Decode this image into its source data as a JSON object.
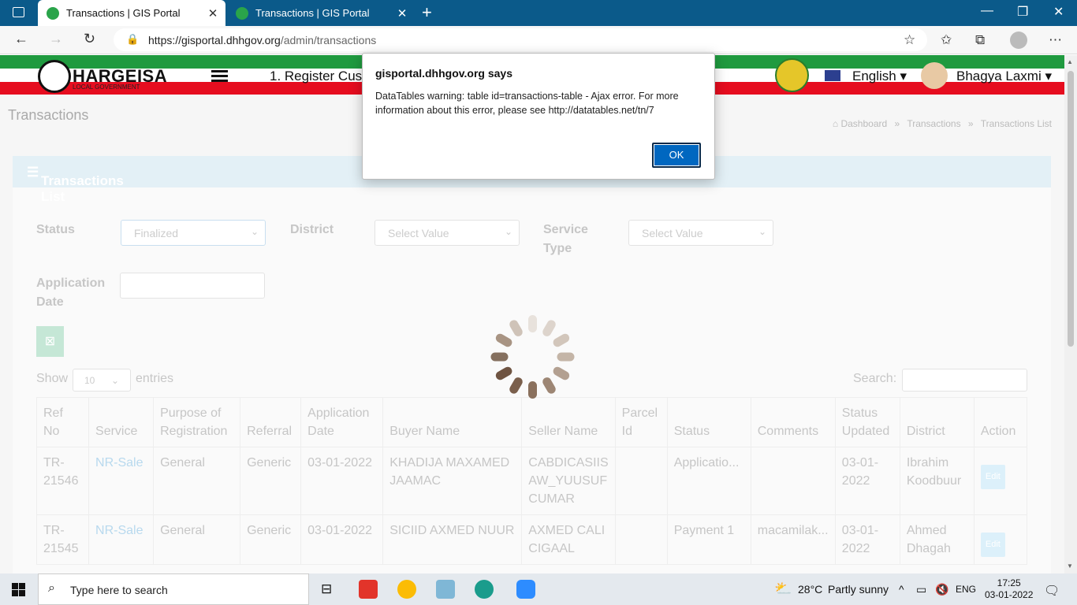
{
  "browser": {
    "tabs": [
      {
        "title": "Transactions | GIS Portal",
        "active": true
      },
      {
        "title": "Transactions | GIS Portal",
        "active": false
      }
    ],
    "url_main": "https://gisportal.dhhgov.org",
    "url_path": "/admin/transactions"
  },
  "header": {
    "logo_title": "HARGEISA",
    "logo_sub": "LOCAL GOVERNMENT",
    "nav_link": "1. Register Cust",
    "language": "English",
    "user": "Bhagya Laxmi"
  },
  "page": {
    "title": "Transactions",
    "breadcrumb": [
      "Dashboard",
      "Transactions",
      "Transactions List"
    ],
    "card_title": "Transactions List",
    "filters": {
      "status_label": "Status",
      "status_value": "Finalized",
      "district_label": "District",
      "district_value": "Select Value",
      "service_type_label_1": "Service",
      "service_type_label_2": "Type",
      "service_type_value": "Select Value",
      "app_date_label_1": "Application",
      "app_date_label_2": "Date"
    },
    "show_label": "Show",
    "entries_value": "10",
    "entries_label": "entries",
    "search_label": "Search:"
  },
  "table": {
    "headers": [
      "Ref No",
      "Service",
      "Purpose of Registration",
      "Referral",
      "Application Date",
      "Buyer Name",
      "Seller Name",
      "Parcel Id",
      "Status",
      "Comments",
      "Status Updated",
      "District",
      "Action"
    ],
    "rows": [
      {
        "ref": "TR-21546",
        "service": "NR-Sale",
        "purpose": "General",
        "referral": "Generic",
        "app_date": "03-01-2022",
        "buyer": "KHADIJA MAXAMED JAAMAC",
        "seller": "CABDICASIIS AW_YUUSUF CUMAR",
        "parcel": "",
        "status": "Applicatio...",
        "comments": "",
        "updated": "03-01-2022",
        "district": "Ibrahim Koodbuur",
        "action": "Edit"
      },
      {
        "ref": "TR-21545",
        "service": "NR-Sale",
        "purpose": "General",
        "referral": "Generic",
        "app_date": "03-01-2022",
        "buyer": "SICIID AXMED NUUR",
        "seller": "AXMED CALI CIGAAL",
        "parcel": "",
        "status": "Payment 1",
        "comments": "macamilak...",
        "updated": "03-01-2022",
        "district": "Ahmed Dhagah",
        "action": "Edit"
      }
    ]
  },
  "dialog": {
    "title": "gisportal.dhhgov.org says",
    "message": "DataTables warning: table id=transactions-table - Ajax error. For more information about this error, please see http://datatables.net/tn/7",
    "ok": "OK"
  },
  "taskbar": {
    "search_placeholder": "Type here to search",
    "weather_temp": "28°C",
    "weather_desc": "Partly sunny",
    "lang": "ENG",
    "time": "17:25",
    "date": "03-01-2022"
  },
  "colors": {
    "flag_green": "#1f9a3f",
    "flag_red": "#e60d1f",
    "accent_blue": "#0067c0",
    "tabbar": "#0b5a8a"
  }
}
